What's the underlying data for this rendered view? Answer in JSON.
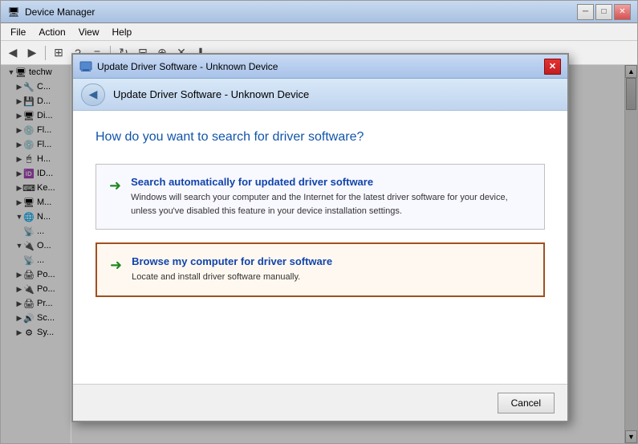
{
  "window": {
    "title": "Device Manager",
    "title_icon": "🖥",
    "close_label": "✕",
    "minimize_label": "─",
    "maximize_label": "□"
  },
  "menubar": {
    "items": [
      {
        "label": "File"
      },
      {
        "label": "Action"
      },
      {
        "label": "View"
      },
      {
        "label": "Help"
      }
    ]
  },
  "toolbar": {
    "buttons": [
      {
        "icon": "◀",
        "name": "back"
      },
      {
        "icon": "▶",
        "name": "forward"
      },
      {
        "icon": "⊞",
        "name": "grid"
      },
      {
        "icon": "?",
        "name": "help-question"
      },
      {
        "icon": "≡",
        "name": "properties"
      },
      {
        "icon": "↻",
        "name": "refresh"
      },
      {
        "icon": "⊟",
        "name": "scan"
      },
      {
        "icon": "⊕",
        "name": "add"
      },
      {
        "icon": "✕",
        "name": "remove"
      },
      {
        "icon": "⬇",
        "name": "update"
      }
    ]
  },
  "tree": {
    "root_label": "techw",
    "items": [
      {
        "indent": 1,
        "label": "C..."
      },
      {
        "indent": 1,
        "label": "D..."
      },
      {
        "indent": 1,
        "label": "Di..."
      },
      {
        "indent": 1,
        "label": "Fl..."
      },
      {
        "indent": 1,
        "label": "Fl..."
      },
      {
        "indent": 1,
        "label": "H..."
      },
      {
        "indent": 1,
        "label": "ID..."
      },
      {
        "indent": 1,
        "label": "Ke..."
      },
      {
        "indent": 1,
        "label": "M..."
      },
      {
        "indent": 1,
        "label": "N..."
      },
      {
        "indent": 2,
        "label": "..."
      },
      {
        "indent": 1,
        "label": "O..."
      },
      {
        "indent": 2,
        "label": "..."
      },
      {
        "indent": 1,
        "label": "Po..."
      },
      {
        "indent": 1,
        "label": "Po..."
      },
      {
        "indent": 1,
        "label": "Pr..."
      },
      {
        "indent": 1,
        "label": "Sc..."
      },
      {
        "indent": 1,
        "label": "Sy..."
      }
    ]
  },
  "dialog": {
    "title": "Update Driver Software - Unknown Device",
    "close_label": "✕",
    "nav_title": "Update Driver Software - Unknown Device",
    "back_icon": "◀",
    "question": "How do you want to search for driver software?",
    "options": [
      {
        "id": "auto",
        "arrow": "➜",
        "title": "Search automatically for updated driver software",
        "description": "Windows will search your computer and the Internet for the latest driver software\nfor your device, unless you've disabled this feature in your device installation\nsettings.",
        "highlighted": false
      },
      {
        "id": "manual",
        "arrow": "➜",
        "title": "Browse my computer for driver software",
        "description": "Locate and install driver software manually.",
        "highlighted": true
      }
    ],
    "footer": {
      "cancel_label": "Cancel"
    }
  }
}
